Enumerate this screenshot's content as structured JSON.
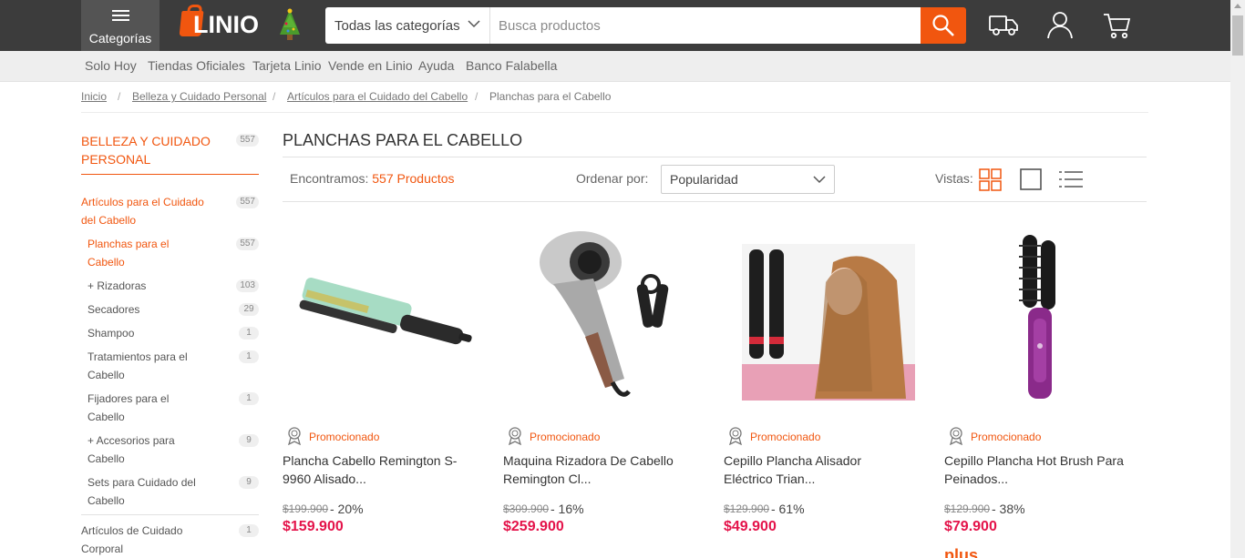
{
  "header": {
    "categories_label": "Categorías",
    "logo_text": "LINIO",
    "search_category": "Todas las categorías",
    "search_placeholder": "Busca productos"
  },
  "subnav": [
    "Solo Hoy",
    "Tiendas Oficiales",
    "Tarjeta Linio",
    "Vende en Linio",
    "Ayuda",
    "Banco Falabella"
  ],
  "breadcrumb": [
    "Inicio",
    "Belleza y Cuidado Personal",
    "Artículos para el Cuidado del Cabello",
    "Planchas para el Cabello"
  ],
  "breadcrumb_sep": "/",
  "sidebar": {
    "top": {
      "label": "BELLEZA Y CUIDADO PERSONAL",
      "count": "557"
    },
    "items": [
      {
        "label": "Artículos para el Cuidado del Cabello",
        "count": "557"
      },
      {
        "label": "Planchas para el Cabello",
        "count": "557"
      },
      {
        "label": "+ Rizadoras",
        "count": "103"
      },
      {
        "label": "Secadores",
        "count": "29"
      },
      {
        "label": "Shampoo",
        "count": "1"
      },
      {
        "label": "Tratamientos para el Cabello",
        "count": "1"
      },
      {
        "label": "Fijadores para el Cabello",
        "count": "1"
      },
      {
        "label": "+ Accesorios para Cabello",
        "count": "9"
      },
      {
        "label": "Sets para Cuidado del Cabello",
        "count": "9"
      },
      {
        "label": "Artículos de Cuidado Corporal",
        "count": "1"
      }
    ]
  },
  "main": {
    "title": "PLANCHAS PARA EL CABELLO",
    "found_prefix": "Encontramos:",
    "found_count": "557 Productos",
    "order_label": "Ordenar por:",
    "order_value": "Popularidad",
    "views_label": "Vistas:"
  },
  "products": [
    {
      "badge": "Promocionado",
      "name": "Plancha Cabello Remington S-9960 Alisado...",
      "old_price": "$199.900",
      "discount": "- 20%",
      "price": "$159.900"
    },
    {
      "badge": "Promocionado",
      "name": "Maquina Rizadora De Cabello Remington Cl...",
      "old_price": "$309.900",
      "discount": "- 16%",
      "price": "$259.900"
    },
    {
      "badge": "Promocionado",
      "name": "Cepillo Plancha Alisador Eléctrico Trian...",
      "old_price": "$129.900",
      "discount": "- 61%",
      "price": "$49.900"
    },
    {
      "badge": "Promocionado",
      "name": "Cepillo Plancha Hot Brush Para Peinados...",
      "old_price": "$129.900",
      "discount": "- 38%",
      "price": "$79.900",
      "extra": "plus"
    }
  ],
  "colors": {
    "brand": "#f1560f",
    "price": "#e4134a",
    "header_bg": "#3c3c3c"
  }
}
